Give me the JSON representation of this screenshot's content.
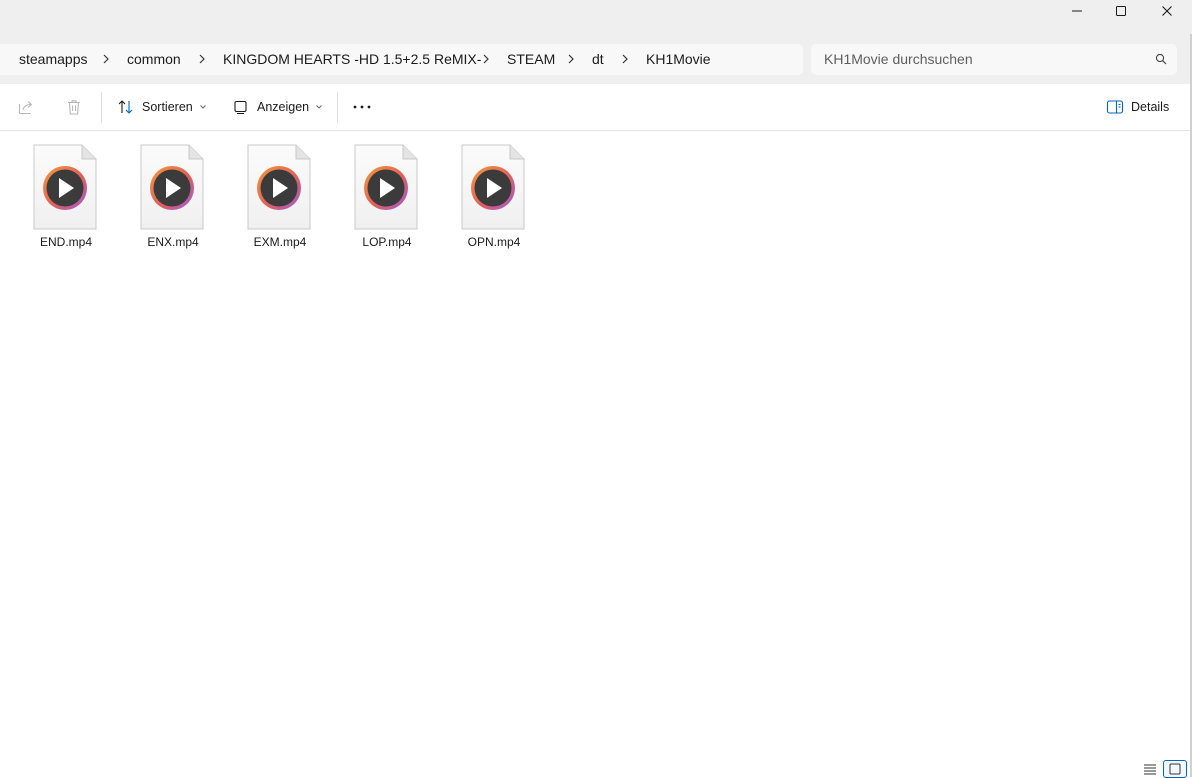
{
  "window": {
    "controls": [
      {
        "name": "minimize-button",
        "icon": "minimize-icon"
      },
      {
        "name": "maximize-button",
        "icon": "maximize-icon"
      },
      {
        "name": "close-button",
        "icon": "close-icon"
      }
    ]
  },
  "breadcrumb": [
    "steamapps",
    "common",
    "KINGDOM HEARTS -HD 1.5+2.5 ReMIX-",
    "STEAM",
    "dt",
    "KH1Movie"
  ],
  "search": {
    "placeholder": "KH1Movie durchsuchen",
    "icon": "search-icon"
  },
  "toolbar": {
    "share_icon": "share-icon",
    "delete_icon": "trash-icon",
    "sort_label": "Sortieren",
    "view_label": "Anzeigen",
    "more_icon": "more-icon",
    "details_label": "Details"
  },
  "files": [
    {
      "name": "END.mp4",
      "icon": "video-file-icon"
    },
    {
      "name": "ENX.mp4",
      "icon": "video-file-icon"
    },
    {
      "name": "EXM.mp4",
      "icon": "video-file-icon"
    },
    {
      "name": "LOP.mp4",
      "icon": "video-file-icon"
    },
    {
      "name": "OPN.mp4",
      "icon": "video-file-icon"
    }
  ],
  "statusbar": {
    "details_view_icon": "list-view-icon",
    "tiles_view_icon": "large-icons-view-icon"
  },
  "colors": {
    "chrome_bg": "#efefef",
    "play_ring_start": "#f08a3c",
    "play_ring_end": "#a45ad8",
    "play_inner": "#3b3b3b",
    "accent": "#0067c0"
  }
}
